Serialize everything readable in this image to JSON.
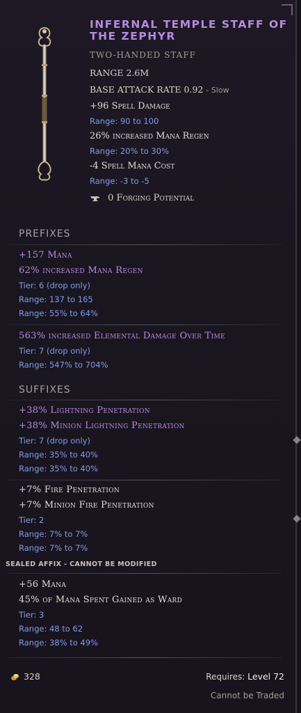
{
  "item": {
    "name": "INFERNAL TEMPLE STAFF OF THE ZEPHYR",
    "base_type": "TWO-HANDED STAFF",
    "range_text": "RANGE 2.6M",
    "attack_rate_label": "BASE ATTACK RATE 0.92",
    "attack_rate_speed": "- Slow",
    "implicits": [
      {
        "mod": "+96 Spell Damage",
        "range": "Range: 90 to 100"
      },
      {
        "mod": "26% increased Mana Regen",
        "range": "Range: 20% to 30%"
      },
      {
        "mod": "-4 Spell Mana Cost",
        "range": "Range: -3 to -5"
      }
    ],
    "forging_potential": "0 Forging Potential"
  },
  "prefixes": {
    "title": "PREFIXES",
    "affixes": [
      {
        "lines": [
          "+157 Mana",
          "62% increased Mana Regen"
        ],
        "tier": "Tier: 6 (drop only)",
        "ranges": [
          "Range: 137 to 165",
          "Range: 55% to 64%"
        ]
      },
      {
        "lines": [
          "563% increased Elemental Damage Over Time"
        ],
        "tier": "Tier: 7 (drop only)",
        "ranges": [
          "Range: 547% to 704%"
        ]
      }
    ]
  },
  "suffixes": {
    "title": "SUFFIXES",
    "affixes": [
      {
        "lines": [
          "+38% Lightning Penetration",
          "+38% Minion Lightning Penetration"
        ],
        "tier": "Tier: 7 (drop only)",
        "ranges": [
          "Range: 35% to 40%",
          "Range: 35% to 40%"
        ]
      },
      {
        "lines": [
          "+7% Fire Penetration",
          "+7% Minion Fire Penetration"
        ],
        "tier": "Tier: 2",
        "ranges": [
          "Range: 7% to 7%",
          "Range: 7% to 7%"
        ]
      }
    ]
  },
  "sealed": {
    "label": "SEALED AFFIX - CANNOT BE MODIFIED",
    "lines": [
      "+56 Mana",
      "45% of Mana Spent Gained as Ward"
    ],
    "tier": "Tier: 3",
    "ranges": [
      "Range: 48 to 62",
      "Range: 38% to 49%"
    ]
  },
  "footer": {
    "gold": "328",
    "requires_label": "Requires:",
    "requires_level": "Level 72",
    "trade": "Cannot be Traded"
  },
  "colors": {
    "title_purple": "#b48ae0",
    "range_blue": "#7f9be8",
    "background": "#1a1620"
  },
  "icons": {
    "item": "staff-art-icon",
    "forge": "anvil-icon",
    "gold": "gold-coin-icon"
  }
}
